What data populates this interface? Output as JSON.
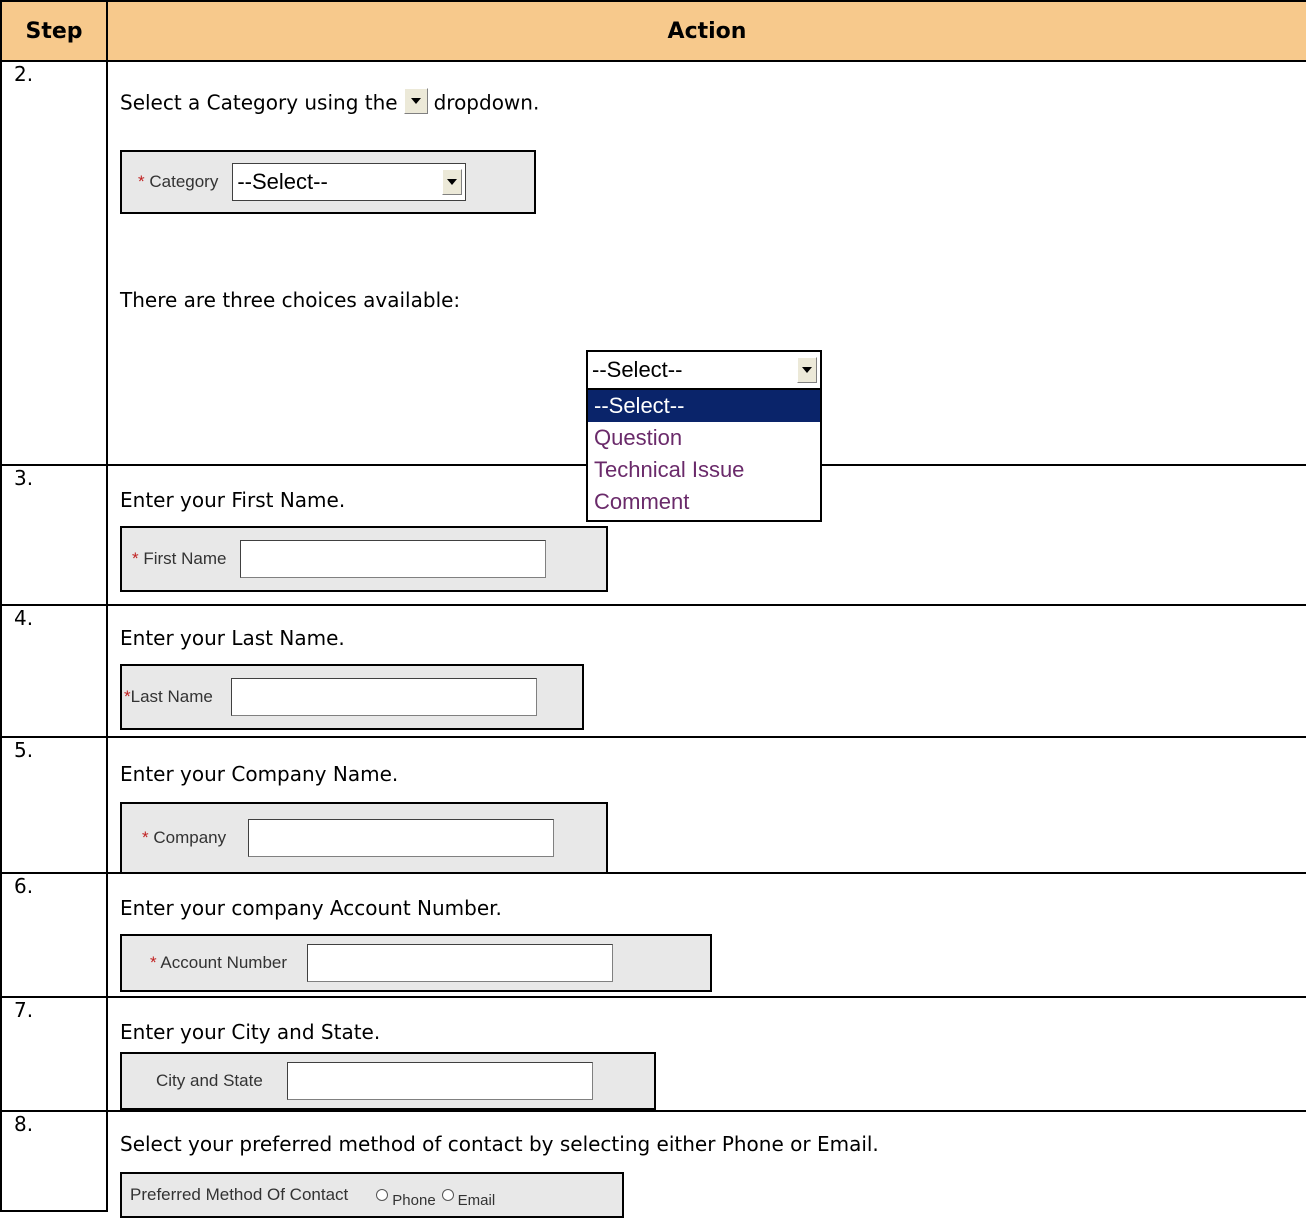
{
  "header": {
    "step": "Step",
    "action": "Action"
  },
  "steps": [
    {
      "num": "2.",
      "text_before": "Select a Category using the",
      "text_after": "dropdown.",
      "field_label": "Category",
      "select_value": "--Select--",
      "choices_text": "There are three choices available:",
      "dropdown": {
        "value": "--Select--",
        "options": [
          "--Select--",
          "Question",
          "Technical Issue",
          "Comment"
        ],
        "highlighted": "--Select--"
      }
    },
    {
      "num": "3.",
      "text": "Enter your First Name.",
      "field_label": "First Name"
    },
    {
      "num": "4.",
      "text": "Enter your Last Name.",
      "field_label": "Last Name"
    },
    {
      "num": "5.",
      "text": "Enter your Company Name.",
      "field_label": "Company"
    },
    {
      "num": "6.",
      "text": "Enter your company Account Number.",
      "field_label": "Account Number"
    },
    {
      "num": "7.",
      "text": "Enter your City and State.",
      "field_label": "City and State"
    },
    {
      "num": "8.",
      "text": "Select your preferred method of contact by selecting either Phone or Email.",
      "field_label": "Preferred Method Of Contact",
      "radio_phone": "Phone",
      "radio_email": "Email"
    }
  ],
  "required_marker": "*",
  "colors": {
    "header_bg": "#f7c98c",
    "panel_bg": "#e8e8e8",
    "highlight": "#0a246a",
    "required": "#c02020"
  }
}
